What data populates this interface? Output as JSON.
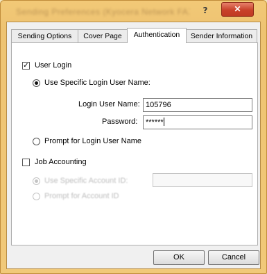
{
  "window": {
    "title": "Sending Preferences (Kyocera Network FAX Driver)",
    "help_label": "?",
    "close_label": "✕"
  },
  "tabs": [
    {
      "label": "Sending Options"
    },
    {
      "label": "Cover Page"
    },
    {
      "label": "Authentication"
    },
    {
      "label": "Sender Information"
    }
  ],
  "auth": {
    "user_login": {
      "label": "User Login",
      "checked": true
    },
    "use_specific": {
      "label": "Use Specific Login User Name:",
      "selected": true
    },
    "login_user_name": {
      "label": "Login User Name:",
      "value": "105796"
    },
    "password": {
      "label": "Password:",
      "value": "******"
    },
    "prompt_login": {
      "label": "Prompt for Login User Name",
      "selected": false
    }
  },
  "job_accounting": {
    "label": "Job Accounting",
    "checked": false,
    "use_specific_account": {
      "label": "Use Specific Account ID:",
      "selected": true,
      "disabled": true
    },
    "account_id_value": "",
    "prompt_account": {
      "label": "Prompt for Account ID",
      "selected": false,
      "disabled": true
    }
  },
  "footer": {
    "ok_label": "OK",
    "cancel_label": "Cancel"
  }
}
